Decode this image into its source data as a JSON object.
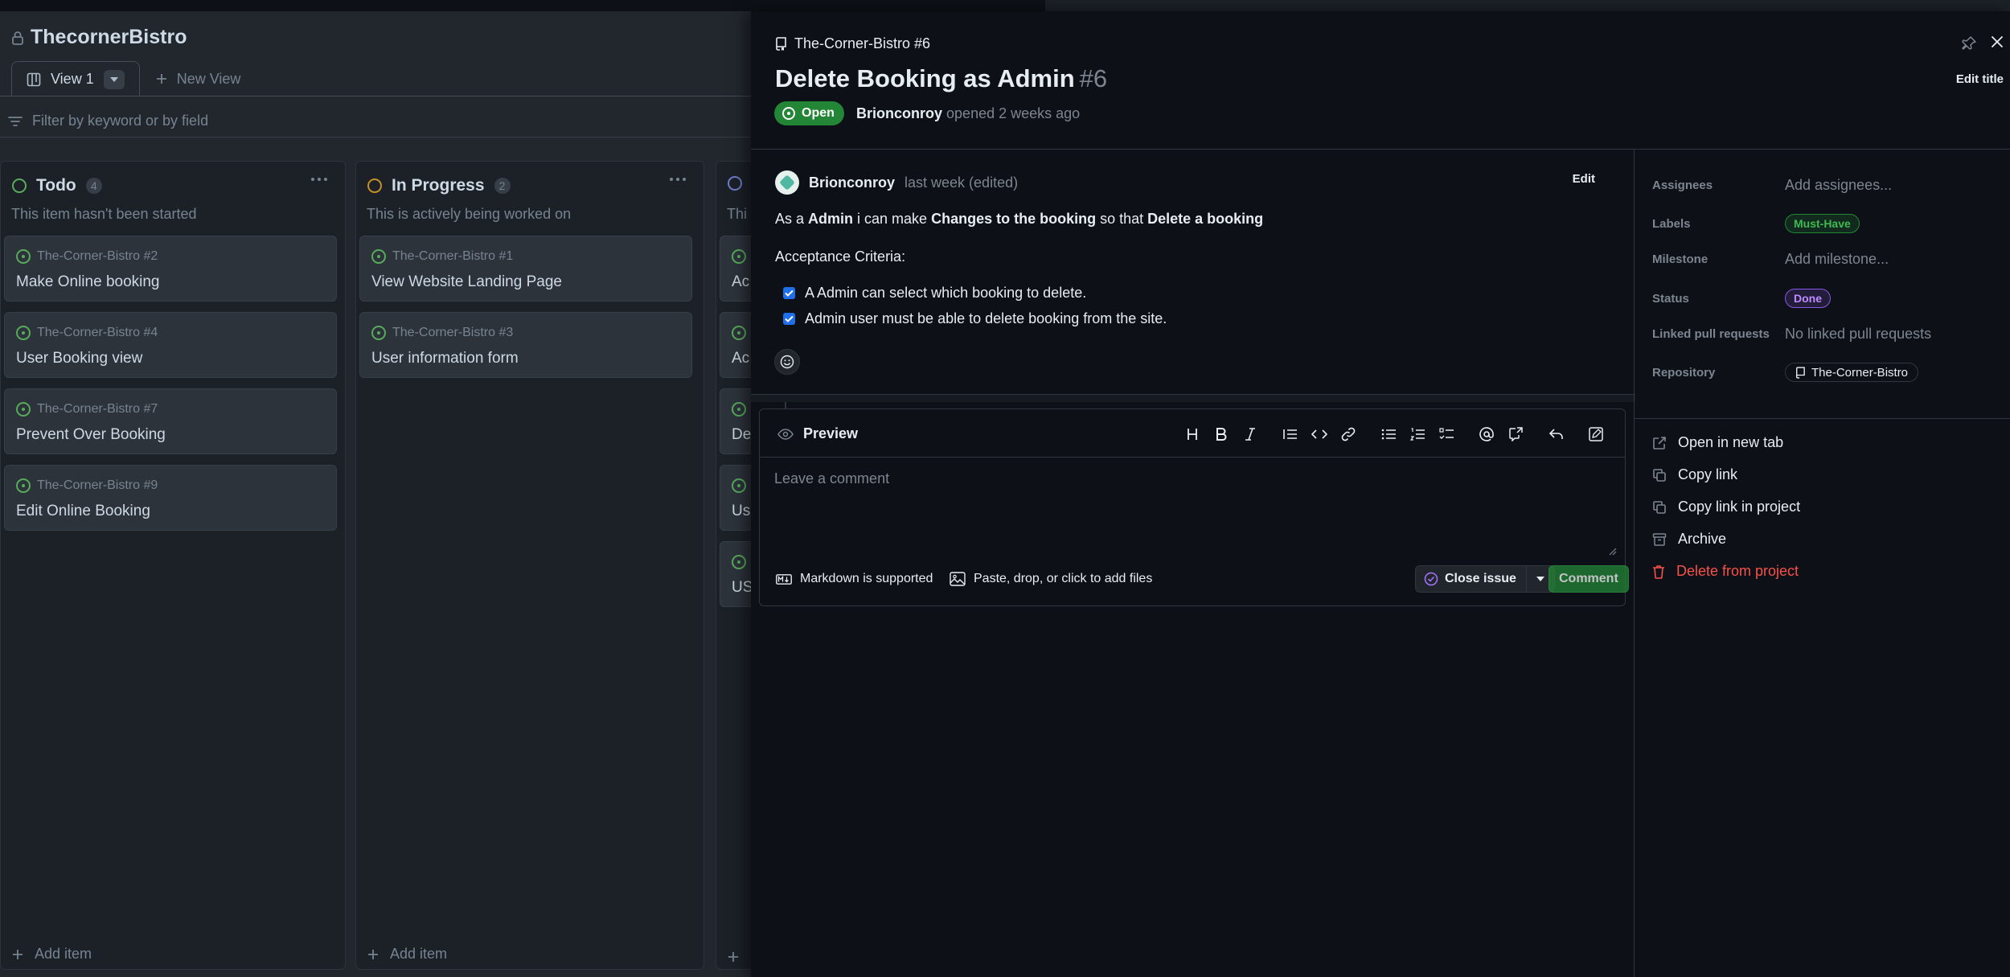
{
  "project": {
    "title": "ThecornerBistro",
    "views": {
      "active": "View 1",
      "new_view": "New View"
    },
    "filter_placeholder": "Filter by keyword or by field",
    "add_item": "Add item",
    "columns": [
      {
        "name": "Todo",
        "count": "4",
        "description": "This item hasn't been started",
        "status_color": "#57ab5a",
        "cards": [
          {
            "ref": "The-Corner-Bistro #2",
            "title": "Make Online booking"
          },
          {
            "ref": "The-Corner-Bistro #4",
            "title": "User Booking view"
          },
          {
            "ref": "The-Corner-Bistro #7",
            "title": "Prevent Over Booking"
          },
          {
            "ref": "The-Corner-Bistro #9",
            "title": "Edit Online Booking"
          }
        ]
      },
      {
        "name": "In Progress",
        "count": "2",
        "description": "This is actively being worked on",
        "status_color": "#c69026",
        "cards": [
          {
            "ref": "The-Corner-Bistro #1",
            "title": "View Website Landing Page"
          },
          {
            "ref": "The-Corner-Bistro #3",
            "title": "User information form"
          }
        ]
      },
      {
        "name": "",
        "count": "",
        "description": "Thi",
        "status_color": "#6e7bc7",
        "cards": [
          {
            "ref": "",
            "title": "Ac"
          },
          {
            "ref": "",
            "title": "Ac"
          },
          {
            "ref": "",
            "title": "De"
          },
          {
            "ref": "",
            "title": "Us"
          },
          {
            "ref": "",
            "title": "US"
          }
        ]
      }
    ]
  },
  "issue": {
    "repo_ref": "The-Corner-Bistro #6",
    "title": "Delete Booking as Admin",
    "number": "#6",
    "state": "Open",
    "author": "Brionconroy",
    "opened_text": "opened 2 weeks ago",
    "edit_title_label": "Edit title",
    "comment": {
      "author": "Brionconroy",
      "meta": "last week (edited)",
      "edit_label": "Edit",
      "story": {
        "p1": "As a ",
        "b1": "Admin",
        "p2": " i can make ",
        "b2": "Changes to the booking",
        "p3": " so that ",
        "b3": "Delete a booking"
      },
      "criteria_heading": "Acceptance Criteria:",
      "tasks": [
        "A Admin can select which booking to delete.",
        "Admin user must be able to delete booking from the site."
      ]
    },
    "composer": {
      "tab_label": "Preview",
      "placeholder": "Leave a comment",
      "markdown_note": "Markdown is supported",
      "attach_note": "Paste, drop, or click to add files",
      "close_issue_label": "Close issue",
      "comment_label": "Comment"
    },
    "sidebar": {
      "assignees": {
        "key": "Assignees",
        "value": "Add assignees..."
      },
      "labels": {
        "key": "Labels",
        "value": "Must-Have"
      },
      "milestone": {
        "key": "Milestone",
        "value": "Add milestone..."
      },
      "status": {
        "key": "Status",
        "value": "Done"
      },
      "linked_prs": {
        "key": "Linked pull requests",
        "value": "No linked pull requests"
      },
      "repository": {
        "key": "Repository",
        "value": "The-Corner-Bistro"
      }
    },
    "actions": {
      "open_new_tab": "Open in new tab",
      "copy_link": "Copy link",
      "copy_link_project": "Copy link in project",
      "archive": "Archive",
      "delete": "Delete from project"
    }
  },
  "colors": {
    "open_green": "#238636",
    "danger_red": "#f85149",
    "done_purple": "#8957e5"
  }
}
